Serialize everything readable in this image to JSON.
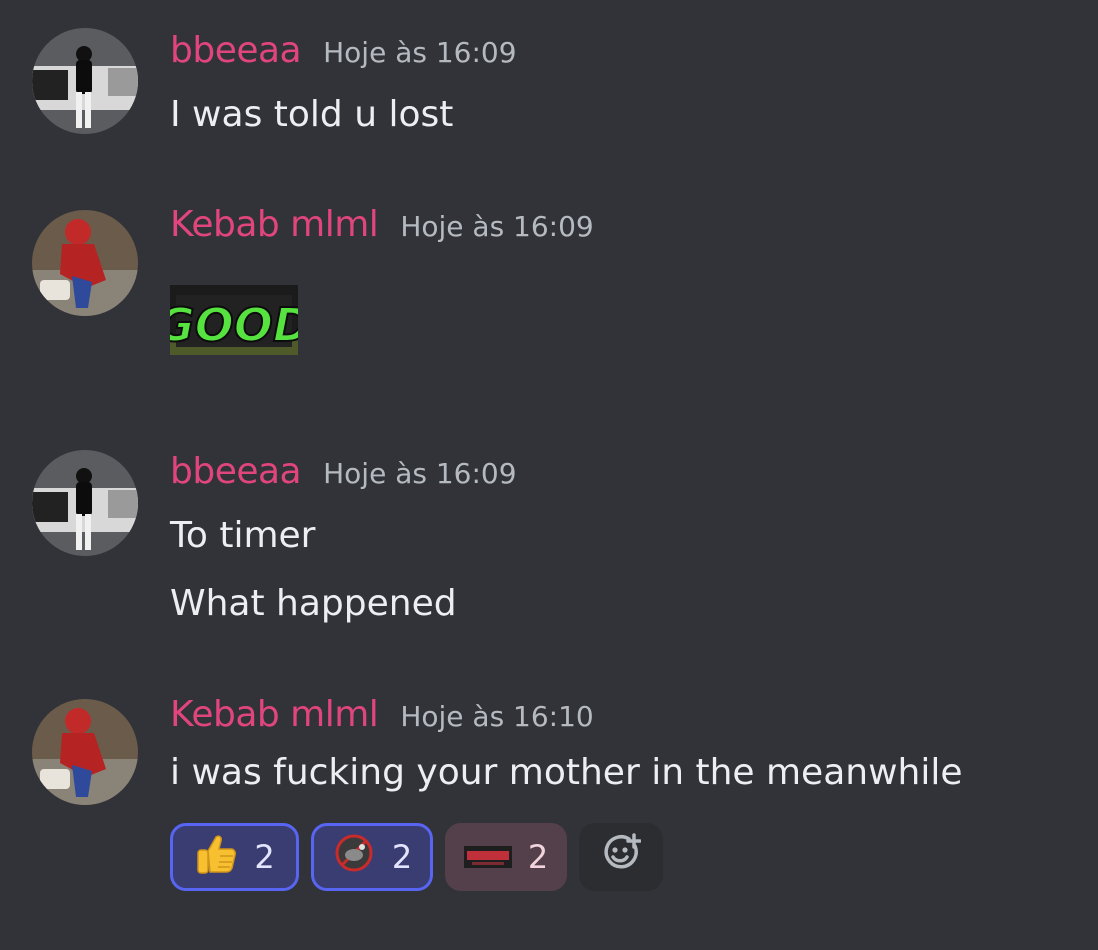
{
  "messages": [
    {
      "author": "bbeeaa",
      "time": "Hoje às 16:09",
      "lines": [
        "I was told u lost"
      ]
    },
    {
      "author": "Kebab mlml",
      "time": "Hoje às 16:09",
      "sticker": "GOOD"
    },
    {
      "author": "bbeeaa",
      "time": "Hoje às 16:09",
      "lines": [
        "To timer",
        "What happened"
      ]
    },
    {
      "author": "Kebab mlml",
      "time": "Hoje às 16:10",
      "lines": [
        "i was fucking your mother in the meanwhile"
      ],
      "reactions": [
        {
          "icon": "thumbs-up-icon",
          "count": "2",
          "reacted": true
        },
        {
          "icon": "custom-sticker-icon",
          "count": "2",
          "reacted": true
        },
        {
          "icon": "custom-banner-icon",
          "count": "2",
          "reacted": false
        }
      ]
    }
  ],
  "colors": {
    "background": "#313338",
    "username": "#e0457b",
    "timestamp": "#b5bac1",
    "text": "#eceef1",
    "reaction_active_border": "#5865f2"
  }
}
